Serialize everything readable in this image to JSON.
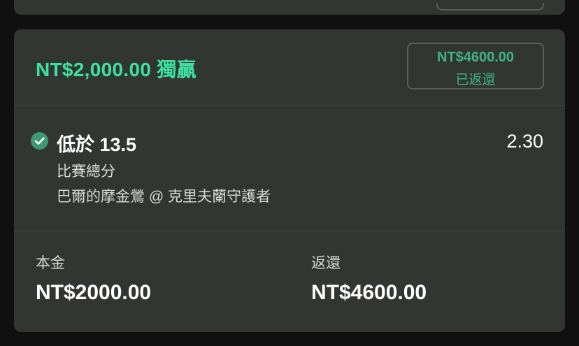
{
  "header": {
    "win_title": "NT$2,000.00 獨贏",
    "returned_amount": "NT$4600.00",
    "returned_label": "已返還"
  },
  "selection": {
    "icon": "check-circle-icon",
    "pick": "低於 13.5",
    "odds": "2.30",
    "market": "比賽總分",
    "event": "巴爾的摩金鶯 @ 克里夫蘭守護者"
  },
  "footer": {
    "stake_label": "本金",
    "stake_value": "NT$2000.00",
    "return_label": "返還",
    "return_value": "NT$4600.00"
  },
  "colors": {
    "accent_green": "#3ee0a0",
    "muted_green": "#3fb38a",
    "card_bg": "#323633",
    "page_bg": "#101010"
  }
}
